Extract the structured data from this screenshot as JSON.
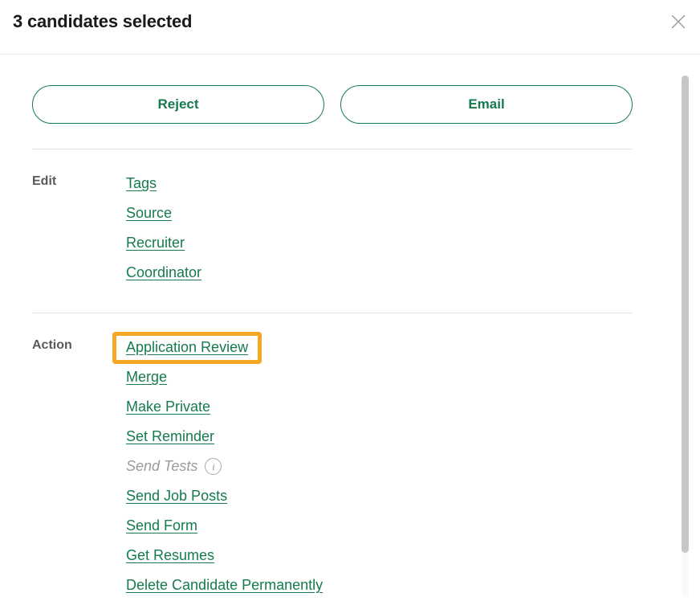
{
  "header": {
    "title": "3 candidates selected",
    "close_icon": "close-icon"
  },
  "buttons": [
    {
      "label": "Reject",
      "name": "reject-button"
    },
    {
      "label": "Email",
      "name": "email-button"
    }
  ],
  "sections": [
    {
      "label": "Edit",
      "items": [
        {
          "label": "Tags",
          "disabled": false,
          "highlighted": false
        },
        {
          "label": "Source",
          "disabled": false,
          "highlighted": false
        },
        {
          "label": "Recruiter",
          "disabled": false,
          "highlighted": false
        },
        {
          "label": "Coordinator",
          "disabled": false,
          "highlighted": false
        }
      ]
    },
    {
      "label": "Action",
      "items": [
        {
          "label": "Application Review",
          "disabled": false,
          "highlighted": true
        },
        {
          "label": "Merge",
          "disabled": false,
          "highlighted": false
        },
        {
          "label": "Make Private",
          "disabled": false,
          "highlighted": false
        },
        {
          "label": "Set Reminder",
          "disabled": false,
          "highlighted": false
        },
        {
          "label": "Send Tests",
          "disabled": true,
          "highlighted": false,
          "info_icon": "i"
        },
        {
          "label": "Send Job Posts",
          "disabled": false,
          "highlighted": false
        },
        {
          "label": "Send Form",
          "disabled": false,
          "highlighted": false
        },
        {
          "label": "Get Resumes",
          "disabled": false,
          "highlighted": false
        },
        {
          "label": "Delete Candidate Permanently",
          "disabled": false,
          "highlighted": false
        }
      ]
    }
  ],
  "colors": {
    "link_green": "#157a4d",
    "highlight_orange": "#f5a623",
    "title_dark": "#1a1a1a",
    "label_gray": "#5a5a5a",
    "disabled_gray": "#9b9b9b"
  }
}
